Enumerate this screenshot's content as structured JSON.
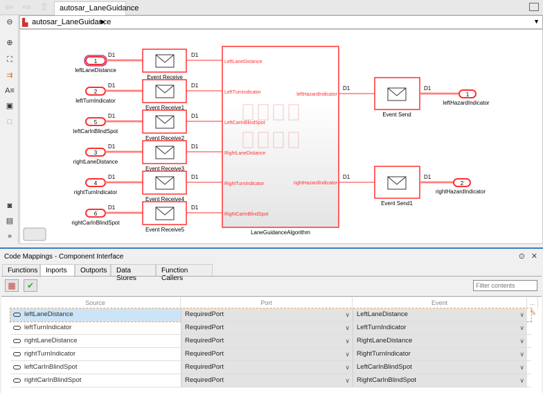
{
  "window": {
    "tab_title": "autosar_LaneGuidance",
    "breadcrumb": "autosar_LaneGuidance"
  },
  "diagram": {
    "inports": [
      {
        "num": "1",
        "name": "leftLaneDistance",
        "signal": "D1",
        "receive": "Event Receive",
        "sub_in": "LeftLaneDistance"
      },
      {
        "num": "2",
        "name": "leftTurnIndicator",
        "signal": "D1",
        "receive": "Event Receive1",
        "sub_in": "LeftTurnIndicator"
      },
      {
        "num": "5",
        "name": "leftCarInBlindSpot",
        "signal": "D1",
        "receive": "Event Receive2",
        "sub_in": "LeftCarInBlindSpot"
      },
      {
        "num": "3",
        "name": "rightLaneDistance",
        "signal": "D1",
        "receive": "Event Receive3",
        "sub_in": "RightLaneDistance"
      },
      {
        "num": "4",
        "name": "rightTurnIndicator",
        "signal": "D1",
        "receive": "Event Receive4",
        "sub_in": "RightTurnIndicator"
      },
      {
        "num": "6",
        "name": "rightCarInBlindSpot",
        "signal": "D1",
        "receive": "Event Receive5",
        "sub_in": "RightCarInBlindSpot"
      }
    ],
    "subsystem": "LaneGuidanceAlgorithm",
    "outports": [
      {
        "num": "1",
        "name": "leftHazardIndicator",
        "signal": "D1",
        "send": "Event Send",
        "sub_out": "leftHazardIndicator"
      },
      {
        "num": "2",
        "name": "rightHazardIndicator",
        "signal": "D1",
        "send": "Event Send1",
        "sub_out": "rightHazardIndicator"
      }
    ],
    "colors": {
      "block": "#ff3030",
      "port_highlight": "#a040a0"
    }
  },
  "panel": {
    "title": "Code Mappings - Component Interface",
    "tabs": [
      "Functions",
      "Inports",
      "Outports",
      "Data Stores",
      "Function Callers"
    ],
    "active_tab": "Inports",
    "filter_placeholder": "Filter contents",
    "columns": [
      "Source",
      "Port",
      "Event",
      "..."
    ],
    "rows": [
      {
        "source": "leftLaneDistance",
        "port": "RequiredPort",
        "event": "LeftLaneDistance"
      },
      {
        "source": "leftTurnIndicator",
        "port": "RequiredPort",
        "event": "LeftTurnIndicator"
      },
      {
        "source": "rightLaneDistance",
        "port": "RequiredPort",
        "event": "RightLaneDistance"
      },
      {
        "source": "rightTurnIndicator",
        "port": "RequiredPort",
        "event": "RightTurnIndicator"
      },
      {
        "source": "leftCarInBlindSpot",
        "port": "RequiredPort",
        "event": "LeftCarInBlindSpot"
      },
      {
        "source": "rightCarInBlindSpot",
        "port": "RequiredPort",
        "event": "RightCarInBlindSpot"
      }
    ]
  }
}
